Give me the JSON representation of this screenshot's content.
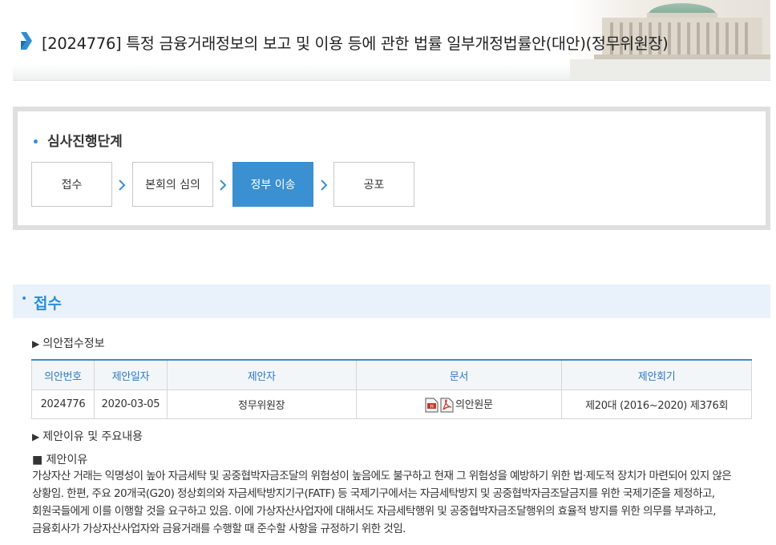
{
  "header": {
    "title": "[2024776] 특정 금융거래정보의 보고 및 이용 등에 관한 법률 일부개정법률안(대안)(정무위원장)"
  },
  "stages": {
    "heading": "심사진행단계",
    "steps": [
      {
        "label": "접수",
        "active": false
      },
      {
        "label": "본회의 심의",
        "active": false
      },
      {
        "label": "정부 이송",
        "active": true
      },
      {
        "label": "공포",
        "active": false
      }
    ]
  },
  "section": {
    "title": "접수",
    "receipt_info_label": "의안접수정보",
    "table": {
      "headers": [
        "의안번호",
        "제안일자",
        "제안자",
        "문서",
        "제안회기"
      ],
      "row": {
        "bill_no": "2024776",
        "date": "2020-03-05",
        "proposer": "정무위원장",
        "document": "의안원문",
        "session": "제20대 (2016~2020) 제376회"
      }
    },
    "reason_section_label": "제안이유 및 주요내용",
    "reason_label": "■ 제안이유",
    "reason_text": "가상자산 거래는 익명성이 높아 자금세탁 및 공중협박자금조달의 위험성이 높음에도 불구하고 현재 그 위험성을 예방하기 위한 법·제도적 장치가 마련되어 있지 않은 상황임. 한편, 주요 20개국(G20) 정상회의와 자금세탁방지기구(FATF) 등 국제기구에서는 자금세탁방지 및 공중협박자금조달금지를 위한 국제기준을 제정하고, 회원국들에게 이를 이행할 것을 요구하고 있음. 이에 가상자산사업자에 대해서도 자금세탁행위 및 공중협박자금조달행위의 효율적 방지를 위한 의무를 부과하고, 금융회사가 가상자산사업자와 금융거래를 수행할 때 준수할 사항을 규정하기 위한 것임."
  },
  "colors": {
    "accent": "#2d8fd6",
    "active_step": "#3a90d0",
    "section_bg": "#e9f2fb"
  }
}
